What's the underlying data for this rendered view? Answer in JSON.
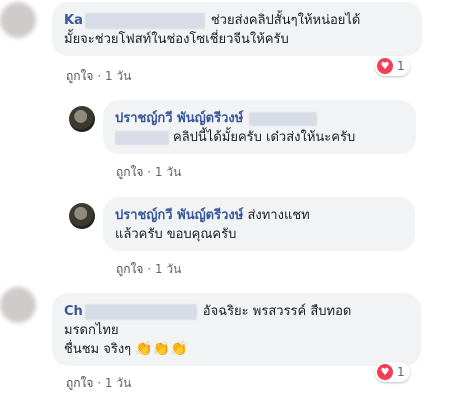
{
  "comments": [
    {
      "name_prefix": "Ka",
      "line1": "ช่วยส่งคลิปสั้นๆให้หน่อยได้",
      "line2": "มั้ยจะช่วยโฟสท์ในช่องโซเชี่ยวจีนให้ครับ",
      "like_label": "ถูกใจ",
      "time": "1 วัน",
      "reaction_count": "1"
    },
    {
      "name": "ปราชญ์กวี พันญ์ตรีวงษ์",
      "text": "คลิปนี้ได้มั้ยครับ เด๋วส่งให้นะครับ",
      "like_label": "ถูกใจ",
      "time": "1 วัน"
    },
    {
      "name": "ปราชญ์กวี พันญ์ตรีวงษ์",
      "line1": "ส่งทางแชท",
      "line2": "แล้วครับ ขอบคุณครับ",
      "like_label": "ถูกใจ",
      "time": "1 วัน"
    },
    {
      "name_prefix": "Ch",
      "line1": "อัจฉริยะ พรสวรรค์ สืบทอด",
      "line2": "มรดกไทย",
      "line3": "ชื่นชม จริงๆ",
      "emoji": "👏👏👏",
      "like_label": "ถูกใจ",
      "time": "1 วัน",
      "reaction_count": "1"
    }
  ],
  "separator": "·",
  "reaction_icon": "heart-icon",
  "colors": {
    "name": "#385898",
    "bubble": "#f2f3f5",
    "heart": "#f33e58"
  }
}
